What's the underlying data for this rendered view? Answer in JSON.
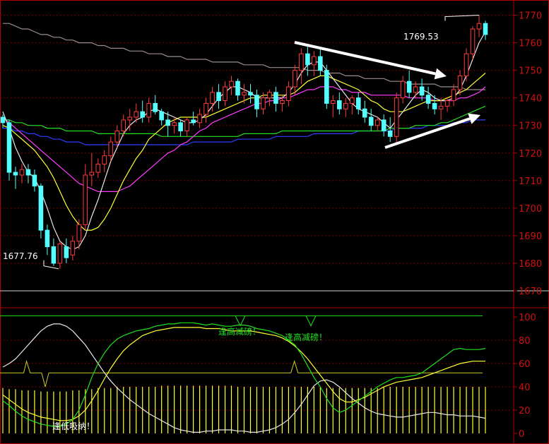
{
  "chart_data": [
    {
      "type": "candlestick",
      "name": "price",
      "ylim": [
        1670,
        1775
      ],
      "y_ticks": [
        "1770",
        "1760",
        "1750",
        "1740",
        "1730",
        "1720",
        "1710",
        "1700",
        "1690",
        "1680",
        "1670"
      ],
      "annotations": {
        "low_label": "1677.76",
        "high_label": "1769.53"
      },
      "colors": {
        "up": "#ff3c3c",
        "down": "#54ffff",
        "ma5": "#e8e8e8",
        "ma10": "#ffff33",
        "ma20": "#ff3cff",
        "ma60": "#20e020",
        "ma120": "#2e3cff",
        "ma250": "#9a8c8c",
        "arrows": "#ffffff"
      },
      "ohlc": [
        [
          1733,
          1734,
          1729,
          1731
        ],
        [
          1731,
          1732,
          1710,
          1713
        ],
        [
          1713,
          1715,
          1707,
          1712
        ],
        [
          1712,
          1716,
          1709,
          1714
        ],
        [
          1714,
          1716,
          1709,
          1712
        ],
        [
          1712,
          1714,
          1706,
          1708
        ],
        [
          1708,
          1709,
          1689,
          1692
        ],
        [
          1692,
          1694,
          1683,
          1686
        ],
        [
          1686,
          1689,
          1679,
          1680
        ],
        [
          1680,
          1688,
          1678,
          1687
        ],
        [
          1686,
          1689,
          1680,
          1682
        ],
        [
          1683,
          1690,
          1681,
          1688
        ],
        [
          1688,
          1696,
          1685,
          1694
        ],
        [
          1694,
          1716,
          1692,
          1712
        ],
        [
          1712,
          1720,
          1708,
          1713
        ],
        [
          1713,
          1718,
          1711,
          1716
        ],
        [
          1716,
          1721,
          1713,
          1719
        ],
        [
          1719,
          1726,
          1717,
          1724
        ],
        [
          1724,
          1730,
          1722,
          1728
        ],
        [
          1728,
          1734,
          1726,
          1732
        ],
        [
          1732,
          1736,
          1728,
          1733
        ],
        [
          1733,
          1738,
          1731,
          1735
        ],
        [
          1735,
          1739,
          1731,
          1733
        ],
        [
          1733,
          1740,
          1731,
          1738
        ],
        [
          1738,
          1741,
          1734,
          1735
        ],
        [
          1735,
          1736,
          1730,
          1732
        ],
        [
          1732,
          1735,
          1726,
          1730
        ],
        [
          1730,
          1733,
          1727,
          1731
        ],
        [
          1731,
          1732,
          1726,
          1728
        ],
        [
          1728,
          1733,
          1726,
          1732
        ],
        [
          1732,
          1735,
          1730,
          1731
        ],
        [
          1731,
          1736,
          1729,
          1734
        ],
        [
          1734,
          1740,
          1731,
          1738
        ],
        [
          1738,
          1744,
          1735,
          1742
        ],
        [
          1742,
          1745,
          1736,
          1739
        ],
        [
          1739,
          1746,
          1737,
          1744
        ],
        [
          1744,
          1748,
          1741,
          1746
        ],
        [
          1746,
          1747,
          1739,
          1741
        ],
        [
          1741,
          1745,
          1738,
          1742
        ],
        [
          1742,
          1745,
          1738,
          1741
        ],
        [
          1741,
          1743,
          1733,
          1736
        ],
        [
          1736,
          1742,
          1734,
          1740
        ],
        [
          1740,
          1743,
          1737,
          1742
        ],
        [
          1742,
          1744,
          1735,
          1738
        ],
        [
          1738,
          1741,
          1735,
          1739
        ],
        [
          1739,
          1746,
          1737,
          1744
        ],
        [
          1744,
          1752,
          1741,
          1750
        ],
        [
          1750,
          1758,
          1745,
          1756
        ],
        [
          1756,
          1759,
          1748,
          1752
        ],
        [
          1752,
          1757,
          1748,
          1755
        ],
        [
          1755,
          1758,
          1748,
          1750
        ],
        [
          1750,
          1752,
          1736,
          1738
        ],
        [
          1738,
          1741,
          1733,
          1739
        ],
        [
          1739,
          1742,
          1734,
          1736
        ],
        [
          1736,
          1740,
          1733,
          1738
        ],
        [
          1738,
          1741,
          1734,
          1740
        ],
        [
          1740,
          1742,
          1734,
          1736
        ],
        [
          1736,
          1739,
          1731,
          1733
        ],
        [
          1733,
          1736,
          1728,
          1730
        ],
        [
          1730,
          1733,
          1728,
          1732
        ],
        [
          1732,
          1734,
          1726,
          1728
        ],
        [
          1728,
          1733,
          1724,
          1726
        ],
        [
          1726,
          1742,
          1723,
          1740
        ],
        [
          1740,
          1748,
          1738,
          1746
        ],
        [
          1746,
          1750,
          1740,
          1742
        ],
        [
          1742,
          1746,
          1740,
          1744
        ],
        [
          1744,
          1747,
          1739,
          1741
        ],
        [
          1741,
          1744,
          1736,
          1738
        ],
        [
          1738,
          1741,
          1734,
          1736
        ],
        [
          1736,
          1740,
          1732,
          1737
        ],
        [
          1737,
          1740,
          1735,
          1739
        ],
        [
          1739,
          1745,
          1737,
          1743
        ],
        [
          1743,
          1750,
          1741,
          1748
        ],
        [
          1748,
          1758,
          1746,
          1756
        ],
        [
          1756,
          1766,
          1754,
          1765
        ],
        [
          1765,
          1770,
          1762,
          1767
        ],
        [
          1767,
          1768,
          1761,
          1763
        ]
      ],
      "ma5": [
        1735,
        1729,
        1722,
        1717,
        1713,
        1711,
        1706,
        1700,
        1693,
        1688,
        1686,
        1685,
        1686,
        1690,
        1697,
        1703,
        1710,
        1717,
        1722,
        1727,
        1730,
        1732,
        1733,
        1735,
        1736,
        1735,
        1734,
        1733,
        1732,
        1731,
        1731,
        1732,
        1734,
        1737,
        1740,
        1742,
        1744,
        1744,
        1743,
        1742,
        1740,
        1740,
        1740,
        1740,
        1740,
        1742,
        1745,
        1749,
        1752,
        1753,
        1753,
        1750,
        1747,
        1744,
        1741,
        1738,
        1736,
        1735,
        1734,
        1733,
        1731,
        1729,
        1732,
        1735,
        1738,
        1741,
        1743,
        1742,
        1740,
        1739,
        1739,
        1740,
        1743,
        1748,
        1754,
        1760,
        1764
      ],
      "ma10": [
        1730,
        1729,
        1727,
        1725,
        1723,
        1721,
        1718,
        1715,
        1711,
        1706,
        1701,
        1697,
        1694,
        1692,
        1692,
        1693,
        1696,
        1700,
        1705,
        1710,
        1714,
        1718,
        1721,
        1725,
        1727,
        1729,
        1731,
        1732,
        1733,
        1733,
        1733,
        1733,
        1733,
        1734,
        1735,
        1736,
        1737,
        1738,
        1739,
        1740,
        1740,
        1741,
        1741,
        1741,
        1741,
        1741,
        1742,
        1744,
        1746,
        1747,
        1748,
        1748,
        1747,
        1746,
        1745,
        1744,
        1743,
        1741,
        1739,
        1738,
        1736,
        1735,
        1735,
        1735,
        1736,
        1737,
        1738,
        1739,
        1739,
        1739,
        1740,
        1741,
        1742,
        1743,
        1745,
        1747,
        1749
      ],
      "ma20": [
        1733,
        1731,
        1729,
        1727,
        1725,
        1723,
        1721,
        1719,
        1717,
        1715,
        1713,
        1711,
        1709,
        1708,
        1707,
        1706,
        1706,
        1706,
        1706,
        1707,
        1708,
        1710,
        1712,
        1714,
        1716,
        1718,
        1720,
        1721,
        1723,
        1724,
        1726,
        1728,
        1729,
        1731,
        1732,
        1733,
        1734,
        1735,
        1736,
        1737,
        1738,
        1738,
        1739,
        1739,
        1740,
        1740,
        1741,
        1742,
        1743,
        1743,
        1744,
        1744,
        1744,
        1743,
        1743,
        1742,
        1742,
        1742,
        1741,
        1741,
        1741,
        1741,
        1741,
        1741,
        1740,
        1740,
        1740,
        1740,
        1739,
        1739,
        1739,
        1739,
        1740,
        1740,
        1741,
        1742,
        1744
      ],
      "ma60": [
        1732,
        1732,
        1731,
        1731,
        1730,
        1730,
        1730,
        1729,
        1729,
        1729,
        1728,
        1728,
        1728,
        1728,
        1728,
        1727,
        1727,
        1727,
        1727,
        1727,
        1727,
        1727,
        1727,
        1727,
        1727,
        1726,
        1726,
        1726,
        1726,
        1726,
        1726,
        1726,
        1726,
        1726,
        1726,
        1726,
        1726,
        1726,
        1727,
        1727,
        1727,
        1727,
        1727,
        1727,
        1728,
        1728,
        1728,
        1728,
        1728,
        1728,
        1728,
        1728,
        1728,
        1728,
        1728,
        1728,
        1728,
        1728,
        1728,
        1728,
        1728,
        1729,
        1729,
        1729,
        1729,
        1730,
        1730,
        1730,
        1730,
        1731,
        1731,
        1732,
        1733,
        1734,
        1735,
        1736,
        1737
      ],
      "ma120": [
        1729,
        1729,
        1728,
        1728,
        1727,
        1727,
        1726,
        1726,
        1725,
        1725,
        1724,
        1724,
        1724,
        1723,
        1723,
        1723,
        1723,
        1723,
        1723,
        1723,
        1723,
        1723,
        1723,
        1723,
        1723,
        1723,
        1723,
        1723,
        1723,
        1723,
        1724,
        1724,
        1724,
        1724,
        1724,
        1724,
        1724,
        1725,
        1725,
        1725,
        1725,
        1725,
        1725,
        1726,
        1726,
        1726,
        1726,
        1726,
        1726,
        1727,
        1727,
        1727,
        1727,
        1727,
        1727,
        1727,
        1728,
        1728,
        1728,
        1728,
        1728,
        1728,
        1729,
        1729,
        1729,
        1729,
        1729,
        1730,
        1730,
        1730,
        1730,
        1731,
        1731,
        1731,
        1732,
        1732,
        1732
      ],
      "ma250": [
        1767,
        1767,
        1766,
        1765,
        1765,
        1764,
        1763,
        1763,
        1762,
        1762,
        1761,
        1761,
        1760,
        1760,
        1760,
        1759,
        1759,
        1758,
        1758,
        1758,
        1757,
        1757,
        1757,
        1756,
        1756,
        1756,
        1755,
        1755,
        1755,
        1754,
        1754,
        1754,
        1754,
        1753,
        1753,
        1753,
        1753,
        1753,
        1752,
        1752,
        1752,
        1752,
        1751,
        1751,
        1751,
        1751,
        1751,
        1751,
        1750,
        1750,
        1750,
        1749,
        1749,
        1749,
        1748,
        1748,
        1748,
        1747,
        1747,
        1747,
        1747,
        1746,
        1746,
        1746,
        1745,
        1745,
        1745,
        1745,
        1745,
        1744,
        1744,
        1744,
        1744,
        1743,
        1743,
        1743,
        1743
      ]
    },
    {
      "type": "line",
      "name": "indicator",
      "ylim": [
        0,
        105
      ],
      "y_ticks": [
        "100",
        "80",
        "60",
        "40",
        "20",
        "0"
      ],
      "annotations": {
        "top_a": "逢高减磅！",
        "top_b": "逢高减磅！",
        "bottom": "逢低吸纳！"
      },
      "colors": {
        "green": "#20e020",
        "yellow": "#ffff33",
        "white": "#e8e8e8",
        "bars": "#ffff33",
        "flat": "#cccc22"
      },
      "green": [
        28,
        24,
        19,
        15,
        12,
        10,
        8,
        7,
        6,
        6,
        8,
        12,
        20,
        33,
        48,
        60,
        69,
        76,
        81,
        84,
        86,
        88,
        89,
        90,
        92,
        93,
        94,
        94,
        95,
        95,
        95,
        94,
        93,
        94,
        93,
        92,
        92,
        93,
        93,
        92,
        90,
        89,
        88,
        86,
        84,
        80,
        76,
        68,
        58,
        48,
        40,
        30,
        22,
        18,
        20,
        24,
        28,
        32,
        36,
        40,
        43,
        46,
        48,
        48,
        49,
        50,
        52,
        56,
        60,
        64,
        68,
        72,
        73,
        72,
        72,
        72,
        73
      ],
      "yellow": [
        33,
        29,
        25,
        21,
        18,
        16,
        14,
        13,
        12,
        11,
        11,
        12,
        15,
        20,
        28,
        37,
        47,
        56,
        64,
        71,
        76,
        80,
        84,
        86,
        88,
        89,
        90,
        91,
        91,
        91,
        91,
        91,
        90,
        90,
        90,
        89,
        88,
        88,
        88,
        88,
        87,
        86,
        85,
        84,
        82,
        79,
        75,
        70,
        64,
        57,
        50,
        43,
        36,
        30,
        27,
        27,
        29,
        31,
        34,
        37,
        40,
        42,
        44,
        45,
        46,
        47,
        48,
        50,
        52,
        54,
        56,
        58,
        60,
        61,
        62,
        62,
        62
      ],
      "white": [
        57,
        60,
        64,
        70,
        76,
        82,
        88,
        92,
        94,
        94,
        92,
        88,
        82,
        76,
        68,
        60,
        52,
        45,
        39,
        34,
        29,
        25,
        21,
        17,
        14,
        11,
        8,
        5,
        3,
        2,
        1,
        1,
        2,
        2,
        3,
        3,
        3,
        2,
        2,
        1,
        1,
        2,
        3,
        5,
        8,
        12,
        18,
        25,
        33,
        41,
        45,
        46,
        44,
        40,
        35,
        30,
        26,
        22,
        19,
        17,
        16,
        15,
        14,
        14,
        15,
        16,
        17,
        18,
        18,
        17,
        16,
        16,
        15,
        15,
        15,
        14,
        13
      ],
      "bars": [
        39,
        38,
        38,
        37,
        37,
        37,
        36,
        36,
        36,
        36,
        36,
        37,
        37,
        38,
        38,
        39,
        39,
        39,
        40,
        40,
        40,
        40,
        40,
        40,
        40,
        41,
        41,
        41,
        41,
        41,
        41,
        41,
        41,
        41,
        41,
        41,
        41,
        40,
        40,
        40,
        40,
        40,
        40,
        40,
        40,
        40,
        40,
        40,
        40,
        40,
        40,
        39,
        39,
        39,
        39,
        39,
        39,
        39,
        39,
        39,
        40,
        40,
        40,
        40,
        40,
        40,
        40,
        40,
        40,
        40,
        40,
        40,
        40,
        40,
        40,
        40,
        40
      ],
      "flat_upper": 101,
      "flat_lower": 52
    }
  ]
}
